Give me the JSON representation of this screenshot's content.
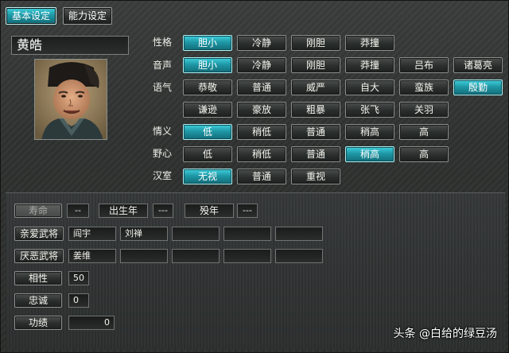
{
  "tabs": [
    {
      "label": "基本设定",
      "active": true
    },
    {
      "label": "能力设定",
      "active": false
    }
  ],
  "character": {
    "name": "黄皓"
  },
  "attributes": {
    "personality": {
      "label": "性格",
      "options": [
        "胆小",
        "冷静",
        "刚胆",
        "莽撞"
      ],
      "selected": "胆小"
    },
    "voice": {
      "label": "音声",
      "options": [
        "胆小",
        "冷静",
        "刚胆",
        "莽撞",
        "吕布",
        "诸葛亮"
      ],
      "selected": "胆小"
    },
    "tone": {
      "label": "语气",
      "options": [
        "恭敬",
        "普通",
        "威严",
        "自大",
        "蛮族",
        "殷勤",
        "谦逊",
        "豪放",
        "粗暴",
        "张飞",
        "关羽"
      ],
      "selected": "殷勤"
    },
    "loyalty_sense": {
      "label": "情义",
      "options": [
        "低",
        "稍低",
        "普通",
        "稍高",
        "高"
      ],
      "selected": "低"
    },
    "ambition": {
      "label": "野心",
      "options": [
        "低",
        "稍低",
        "普通",
        "稍高",
        "高"
      ],
      "selected": "稍高"
    },
    "han_court": {
      "label": "汉室",
      "options": [
        "无视",
        "普通",
        "重视"
      ],
      "selected": "无视"
    }
  },
  "lifespan": {
    "lifespan_label": "寿命",
    "lifespan_value": "--",
    "birth_label": "出生年",
    "birth_value": "---",
    "death_label": "殁年",
    "death_value": "---"
  },
  "relations": {
    "close_label": "亲爱武将",
    "close_values": [
      "阎宇",
      "刘禅",
      "",
      "",
      ""
    ],
    "hated_label": "厌恶武将",
    "hated_values": [
      "姜维",
      "",
      "",
      "",
      ""
    ]
  },
  "stats": {
    "compat_label": "相性",
    "compat_value": "50",
    "loyalty_label": "忠诚",
    "loyalty_value": "0",
    "merit_label": "功绩",
    "merit_value": "0"
  },
  "watermark": "头条 @白给的绿豆汤",
  "colors": {
    "selected": "#1f98a6",
    "background": "#2f3230",
    "border": "#8a8f8c"
  }
}
